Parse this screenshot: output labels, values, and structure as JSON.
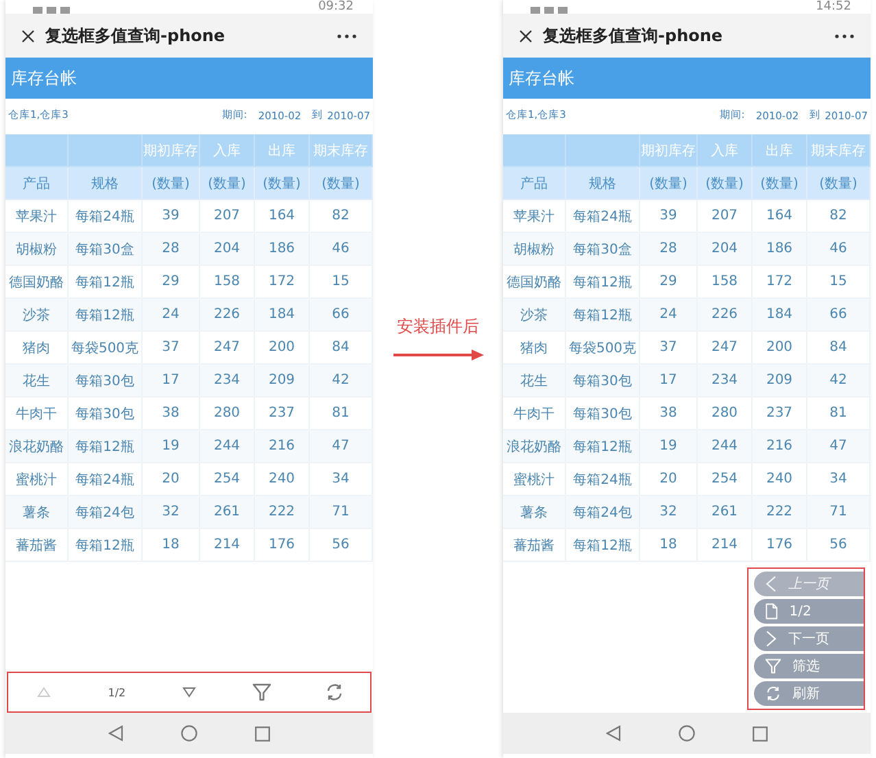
{
  "phones": [
    {
      "status_time": "09:32",
      "title": "复选框多值查询-phone",
      "report_title": "库存台帐",
      "warehouses": "仓库1,仓库3",
      "period_label": "期间:",
      "period_from": "2010-02",
      "to_label": "到",
      "period_to": "2010-07",
      "group_headers": [
        "期初库存",
        "入库",
        "出库",
        "期末库存"
      ],
      "columns": [
        "产品",
        "规格",
        "(数量)",
        "(数量)",
        "(数量)",
        "(数量)"
      ],
      "rows": [
        [
          "苹果汁",
          "每箱24瓶",
          "39",
          "207",
          "164",
          "82"
        ],
        [
          "胡椒粉",
          "每箱30盒",
          "28",
          "204",
          "186",
          "46"
        ],
        [
          "德国奶酪",
          "每箱12瓶",
          "29",
          "158",
          "172",
          "15"
        ],
        [
          "沙茶",
          "每箱12瓶",
          "24",
          "226",
          "184",
          "66"
        ],
        [
          "猪肉",
          "每袋500克",
          "37",
          "247",
          "200",
          "84"
        ],
        [
          "花生",
          "每箱30包",
          "17",
          "234",
          "209",
          "42"
        ],
        [
          "牛肉干",
          "每箱30包",
          "38",
          "280",
          "237",
          "81"
        ],
        [
          "浪花奶酪",
          "每箱12瓶",
          "19",
          "244",
          "216",
          "47"
        ],
        [
          "蜜桃汁",
          "每箱24瓶",
          "20",
          "254",
          "240",
          "34"
        ],
        [
          "薯条",
          "每箱24包",
          "32",
          "261",
          "222",
          "71"
        ],
        [
          "蕃茄酱",
          "每箱12瓶",
          "18",
          "214",
          "176",
          "56"
        ]
      ],
      "toolbar": [
        {
          "kind": "up",
          "disabled": true
        },
        {
          "kind": "page",
          "label": "1/2",
          "disabled": false
        },
        {
          "kind": "down",
          "disabled": false
        },
        {
          "kind": "filter",
          "disabled": false
        },
        {
          "kind": "refresh",
          "disabled": false
        }
      ]
    },
    {
      "status_time": "14:52",
      "title": "复选框多值查询-phone",
      "report_title": "库存台帐",
      "warehouses": "仓库1,仓库3",
      "period_label": "期间:",
      "period_from": "2010-02",
      "to_label": "到",
      "period_to": "2010-07",
      "group_headers": [
        "期初库存",
        "入库",
        "出库",
        "期末库存"
      ],
      "columns": [
        "产品",
        "规格",
        "(数量)",
        "(数量)",
        "(数量)",
        "(数量)"
      ],
      "rows": [
        [
          "苹果汁",
          "每箱24瓶",
          "39",
          "207",
          "164",
          "82"
        ],
        [
          "胡椒粉",
          "每箱30盒",
          "28",
          "204",
          "186",
          "46"
        ],
        [
          "德国奶酪",
          "每箱12瓶",
          "29",
          "158",
          "172",
          "15"
        ],
        [
          "沙茶",
          "每箱12瓶",
          "24",
          "226",
          "184",
          "66"
        ],
        [
          "猪肉",
          "每袋500克",
          "37",
          "247",
          "200",
          "84"
        ],
        [
          "花生",
          "每箱30包",
          "17",
          "234",
          "209",
          "42"
        ],
        [
          "牛肉干",
          "每箱30包",
          "38",
          "280",
          "237",
          "81"
        ],
        [
          "浪花奶酪",
          "每箱12瓶",
          "19",
          "244",
          "216",
          "47"
        ],
        [
          "蜜桃汁",
          "每箱24瓶",
          "20",
          "254",
          "240",
          "34"
        ],
        [
          "薯条",
          "每箱24包",
          "32",
          "261",
          "222",
          "71"
        ],
        [
          "蕃茄酱",
          "每箱12瓶",
          "18",
          "214",
          "176",
          "56"
        ]
      ],
      "floating_menu": [
        {
          "kind": "prev",
          "label": "上一页",
          "disabled": true
        },
        {
          "kind": "page",
          "label": "1/2",
          "disabled": false
        },
        {
          "kind": "next",
          "label": "下一页",
          "disabled": false
        },
        {
          "kind": "filter",
          "label": "筛选",
          "disabled": false
        },
        {
          "kind": "refresh",
          "label": "刷新",
          "disabled": false
        }
      ]
    }
  ],
  "annotation": {
    "text": "安装插件后"
  }
}
